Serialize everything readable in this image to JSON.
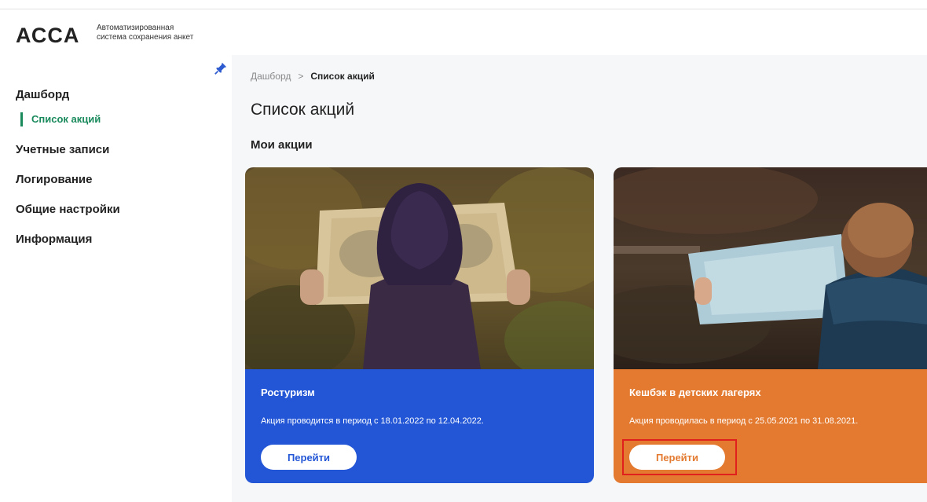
{
  "header": {
    "logo": "АСCA",
    "subtitle_line1": "Автоматизированная",
    "subtitle_line2": "система сохранения анкет"
  },
  "sidebar": {
    "items": [
      {
        "label": "Дашборд"
      },
      {
        "label": "Список акций",
        "active": true
      },
      {
        "label": "Учетные записи"
      },
      {
        "label": "Логирование"
      },
      {
        "label": "Общие настройки"
      },
      {
        "label": "Информация"
      }
    ],
    "icon": "pin-icon"
  },
  "breadcrumb": {
    "parent": "Дашборд",
    "separator": ">",
    "current": "Список акций"
  },
  "page": {
    "title": "Список акций",
    "section": "Мои акции"
  },
  "cards": [
    {
      "name": "Ростуризм",
      "text": "Акция проводится в период с 18.01.2022 по 12.04.2022.",
      "button": "Перейти",
      "color": "#2356d6"
    },
    {
      "name": "Кешбэк в детских лагерях",
      "text": "Акция проводилась в период с 25.05.2021 по 31.08.2021.",
      "button": "Перейти",
      "color": "#e37a30",
      "highlighted": true
    }
  ],
  "colors": {
    "accent_green": "#1a8a5c",
    "highlight_red": "#e0201c"
  }
}
